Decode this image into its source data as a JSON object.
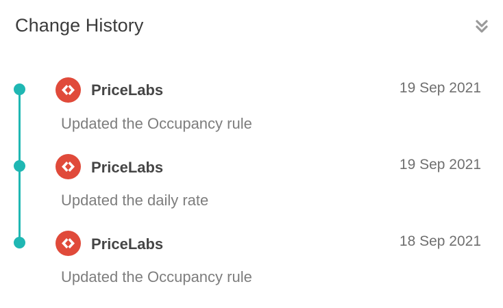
{
  "header": {
    "title": "Change History",
    "collapse_icon": "double-chevron-down-icon"
  },
  "colors": {
    "timeline": "#1fb7b3",
    "logo": "#e04a3a"
  },
  "entries": [
    {
      "author": "PriceLabs",
      "date": "19 Sep 2021",
      "description": "Updated the Occupancy rule",
      "icon": "pricelabs-logo-icon"
    },
    {
      "author": "PriceLabs",
      "date": "19 Sep 2021",
      "description": "Updated the daily rate",
      "icon": "pricelabs-logo-icon"
    },
    {
      "author": "PriceLabs",
      "date": "18 Sep 2021",
      "description": "Updated the Occupancy rule",
      "icon": "pricelabs-logo-icon"
    }
  ]
}
